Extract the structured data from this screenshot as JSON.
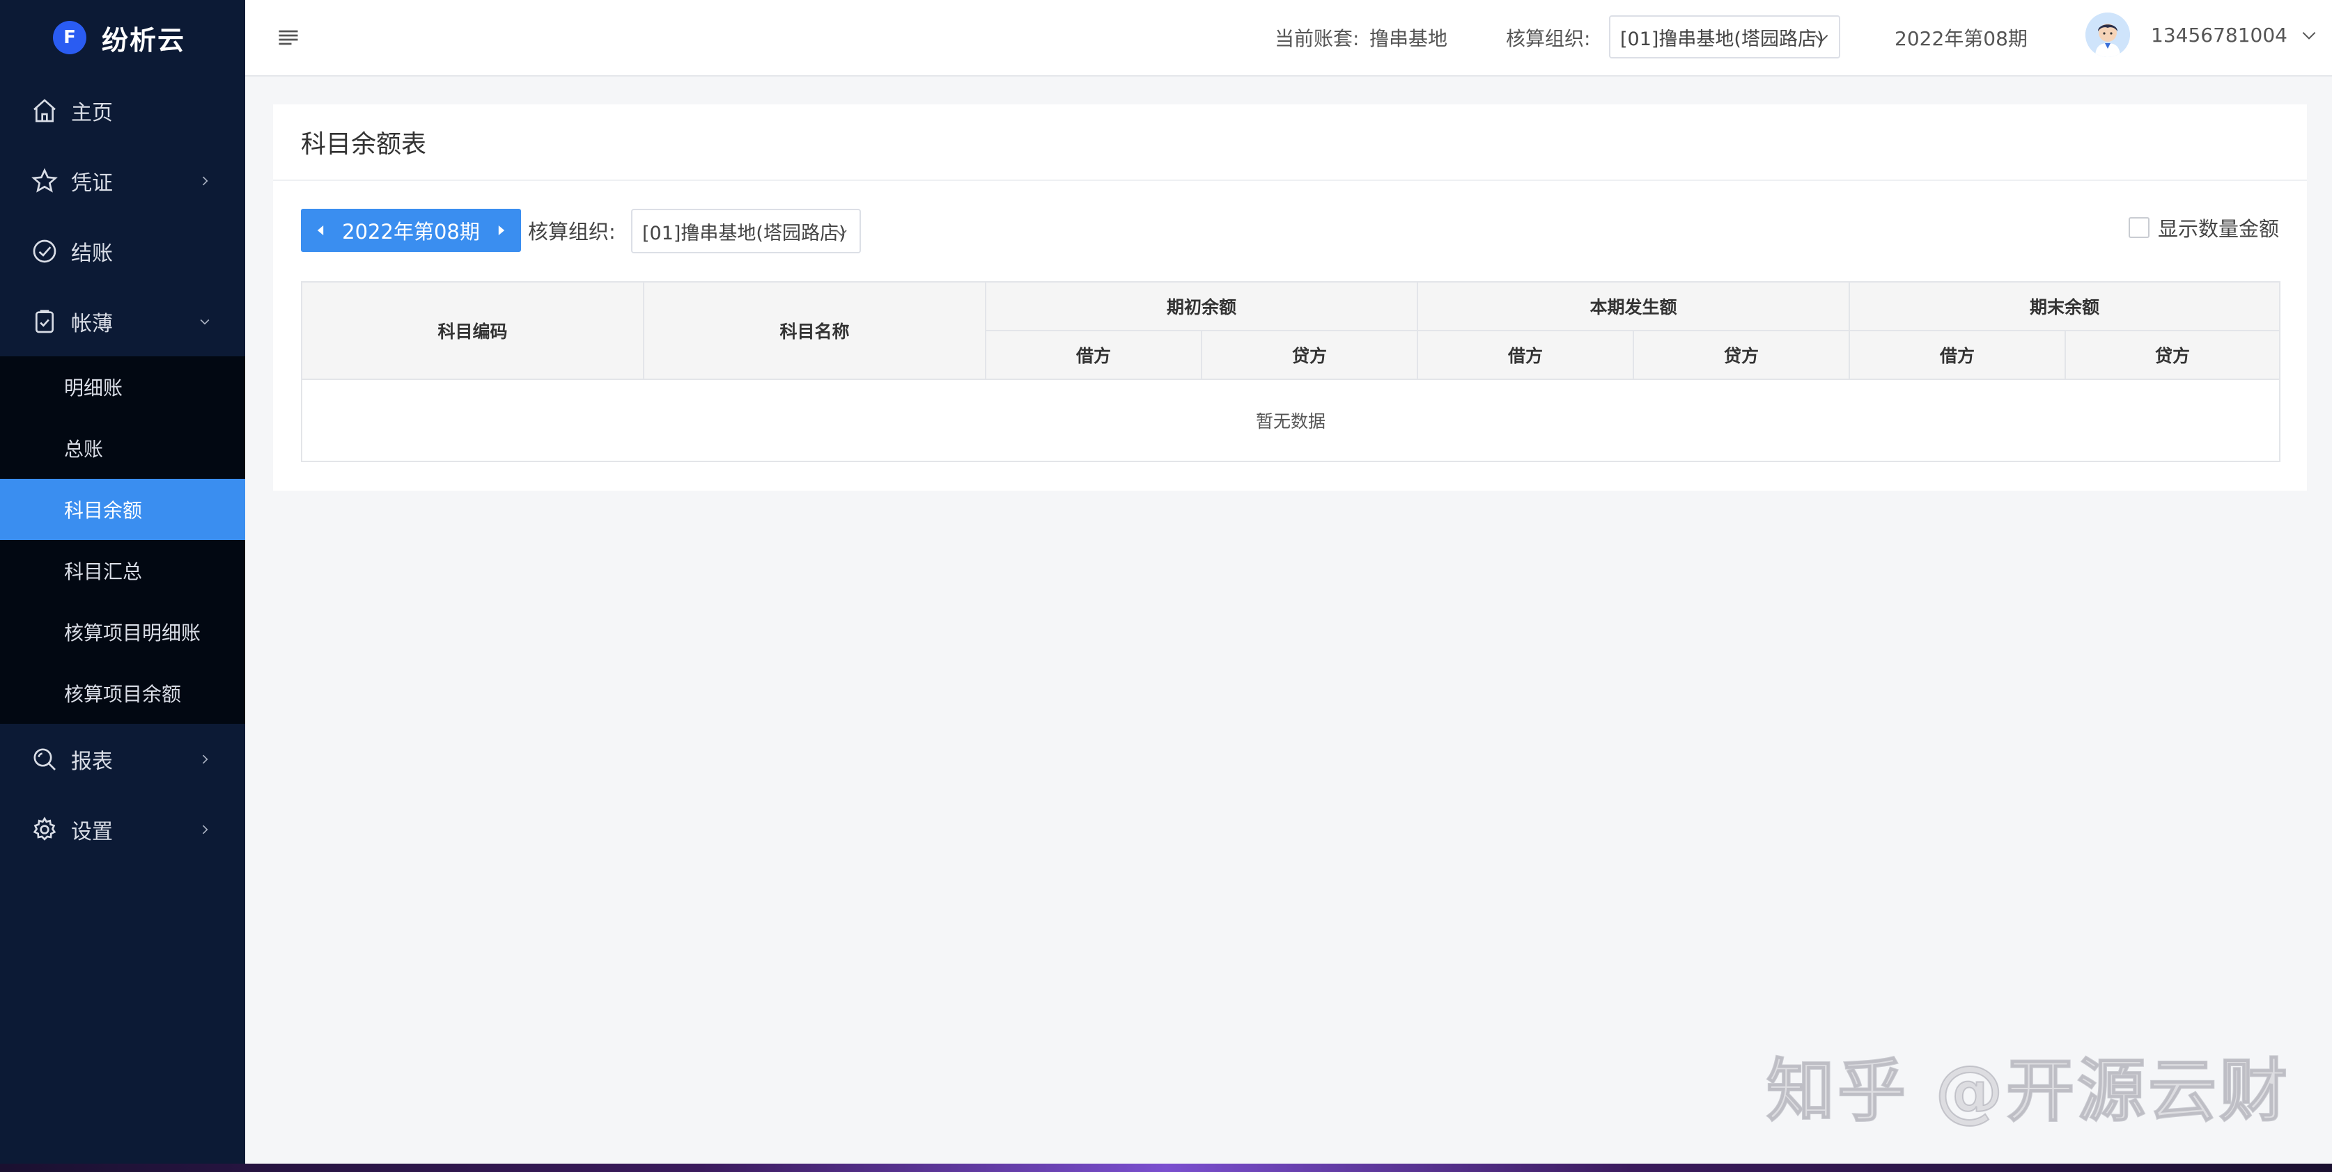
{
  "app": {
    "brand_letter": "F",
    "brand_name": "纷析云"
  },
  "sidebar": {
    "items": [
      {
        "label": "主页",
        "icon": "home-icon"
      },
      {
        "label": "凭证",
        "icon": "star-icon"
      },
      {
        "label": "结账",
        "icon": "check-circle-icon"
      },
      {
        "label": "帐薄",
        "icon": "clipboard-icon"
      },
      {
        "label": "报表",
        "icon": "search-icon"
      },
      {
        "label": "设置",
        "icon": "gear-icon"
      }
    ],
    "submenu": [
      {
        "label": "明细账"
      },
      {
        "label": "总账"
      },
      {
        "label": "科目余额"
      },
      {
        "label": "科目汇总"
      },
      {
        "label": "核算项目明细账"
      },
      {
        "label": "核算项目余额"
      }
    ]
  },
  "header": {
    "account_label": "当前账套:",
    "account_value": "撸串基地",
    "org_label": "核算组织:",
    "org_value": "[01]撸串基地(塔园路店)",
    "period": "2022年第08期",
    "user_phone": "13456781004"
  },
  "main": {
    "title": "科目余额表",
    "period_label": "2022年第08期",
    "org_label": "核算组织:",
    "org_value": "[01]撸串基地(塔园路店)",
    "show_qty_label": "显示数量金额",
    "show_qty_checked": false,
    "table": {
      "col_code": "科目编码",
      "col_name": "科目名称",
      "group_opening": "期初余额",
      "group_current": "本期发生额",
      "group_ending": "期末余额",
      "debit": "借方",
      "credit": "贷方",
      "empty_text": "暂无数据"
    }
  },
  "watermark": "知乎 @开源云财"
}
